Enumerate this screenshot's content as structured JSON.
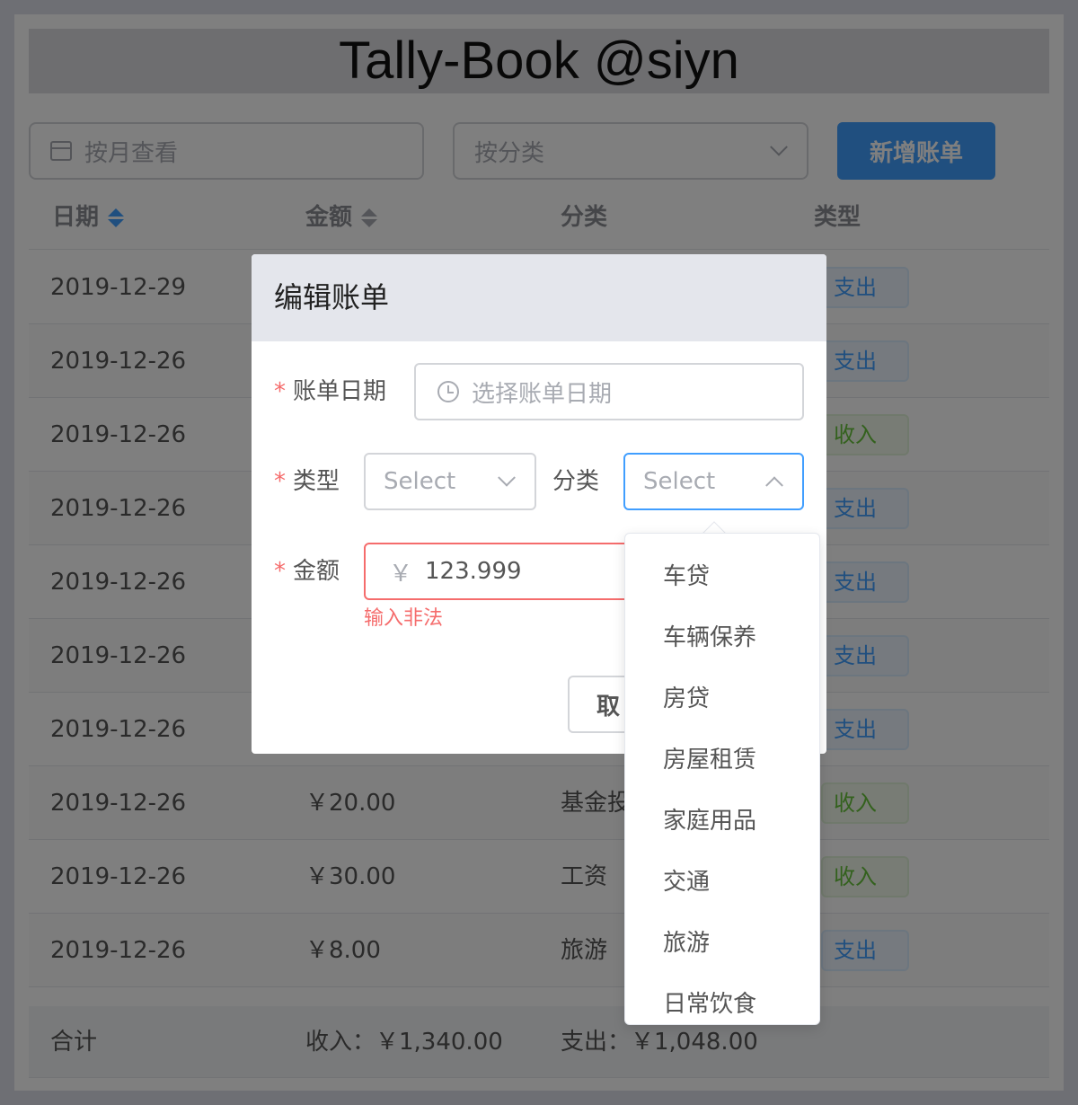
{
  "app": {
    "title": "Tally-Book @siyn"
  },
  "filters": {
    "month_placeholder": "按月查看",
    "category_placeholder": "按分类",
    "add_button": "新增账单"
  },
  "table": {
    "headers": {
      "date": "日期",
      "amount": "金额",
      "category": "分类",
      "type": "类型"
    },
    "rows": [
      {
        "date": "2019-12-29",
        "amount": "",
        "category": "",
        "type": "支出"
      },
      {
        "date": "2019-12-26",
        "amount": "",
        "category": "",
        "type": "支出"
      },
      {
        "date": "2019-12-26",
        "amount": "",
        "category": "",
        "type": "收入"
      },
      {
        "date": "2019-12-26",
        "amount": "",
        "category": "",
        "type": "支出"
      },
      {
        "date": "2019-12-26",
        "amount": "",
        "category": "",
        "type": "支出"
      },
      {
        "date": "2019-12-26",
        "amount": "",
        "category": "",
        "type": "支出"
      },
      {
        "date": "2019-12-26",
        "amount": "",
        "category": "",
        "type": "支出"
      },
      {
        "date": "2019-12-26",
        "amount": "￥20.00",
        "category": "基金投",
        "type": "收入"
      },
      {
        "date": "2019-12-26",
        "amount": "￥30.00",
        "category": "工资",
        "type": "收入"
      },
      {
        "date": "2019-12-26",
        "amount": "￥8.00",
        "category": "旅游",
        "type": "支出"
      }
    ]
  },
  "footer": {
    "label": "合计",
    "income": "收入：￥1,340.00",
    "expense": "支出：￥1,048.00"
  },
  "dialog": {
    "title": "编辑账单",
    "required_mark": "*",
    "date_label": "账单日期",
    "date_placeholder": "选择账单日期",
    "type_label": "类型",
    "type_placeholder": "Select",
    "category_label": "分类",
    "category_placeholder": "Select",
    "amount_label": "金额",
    "amount_prefix": "￥",
    "amount_value": "123.999",
    "amount_error": "输入非法",
    "cancel_button": "取"
  },
  "dropdown": {
    "options": [
      "车贷",
      "车辆保养",
      "房贷",
      "房屋租赁",
      "家庭用品",
      "交通",
      "旅游",
      "日常饮食"
    ]
  },
  "colors": {
    "primary": "#409eff",
    "success": "#67c23a",
    "danger": "#f56c6c"
  }
}
